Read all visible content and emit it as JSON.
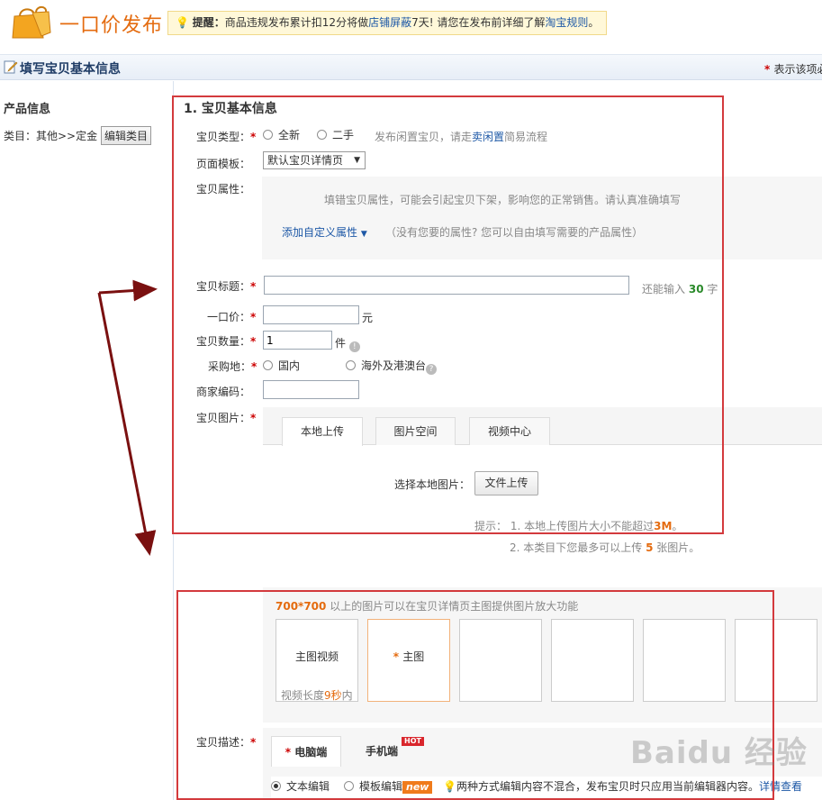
{
  "header": {
    "title": "一口价发布",
    "tip_label": "提醒：",
    "tip_text": "商品违规发布累计扣12分将做",
    "tip_link1": "店铺屏蔽",
    "tip_mid": "7天! 请您在发布前详细了解",
    "tip_link2": "淘宝规则",
    "tip_end": "。"
  },
  "bar": {
    "title": "填写宝贝基本信息",
    "required_note": "表示该项必"
  },
  "sidebar": {
    "section_title": "产品信息",
    "category_label": "类目：其他>>定金",
    "edit_button": "编辑类目"
  },
  "form": {
    "section_title": "1. 宝贝基本信息",
    "type_label": "宝贝类型：",
    "type_options": [
      "全新",
      "二手"
    ],
    "type_hint_pre": "发布闲置宝贝，请走",
    "type_hint_link": "卖闲置",
    "type_hint_post": "简易流程",
    "template_label": "页面模板：",
    "template_value": "默认宝贝详情页",
    "attr_label": "宝贝属性：",
    "attr_warning": "填错宝贝属性，可能会引起宝贝下架，影响您的正常销售。请认真准确填写",
    "attr_custom_link": "添加自定义属性",
    "attr_custom_hint": "（没有您要的属性? 您可以自由填写需要的产品属性）",
    "title_label": "宝贝标题：",
    "title_value": "",
    "title_remaining_pre": "还能输入",
    "title_remaining_count": "30",
    "title_remaining_post": "字",
    "price_label": "一口价：",
    "price_value": "",
    "price_unit": "元",
    "qty_label": "宝贝数量：",
    "qty_value": "1",
    "qty_unit": "件",
    "origin_label": "采购地：",
    "origin_options": [
      "国内",
      "海外及港澳台"
    ],
    "code_label": "商家编码：",
    "code_value": "",
    "images_label": "宝贝图片："
  },
  "upload": {
    "tabs": [
      "本地上传",
      "图片空间",
      "视频中心"
    ],
    "choose_label": "选择本地图片：",
    "file_button": "文件上传",
    "hint_prefix": "提示：",
    "hint1_pre": "1.  本地上传图片大小不能超过",
    "hint1_value": "3M",
    "hint1_post": "。",
    "hint2_pre": "2.  本类目下您最多可以上传",
    "hint2_value": "5",
    "hint2_post": "张图片。"
  },
  "image_slots": {
    "zoom_hint_size": "700*700",
    "zoom_hint_text": "以上的图片可以在宝贝详情页主图提供图片放大功能",
    "video_slot_title": "主图视频",
    "video_slot_note_pre": "视频长度",
    "video_slot_note_value": "9秒",
    "video_slot_note_post": "内",
    "main_slot_title": "主图"
  },
  "description": {
    "label": "宝贝描述：",
    "tabs": [
      "电脑端",
      "手机端"
    ],
    "hot_badge": "HOT",
    "mode_text": "文本编辑",
    "mode_template": "模板编辑",
    "new_badge": "new",
    "mode_note": "两种方式编辑内容不混合，发布宝贝时只应用当前编辑器内容。",
    "details_link": "详情查看"
  },
  "watermark": "Baidu 经验",
  "colors": {
    "accent": "#e46b0f",
    "link": "#1d58a6",
    "required": "#cc0000",
    "annotation": "#d33a3d",
    "arrow": "#7a1010"
  },
  "icons": [
    "shopping-bag-icon",
    "bulb-icon",
    "edit-icon",
    "help-icon",
    "chevron-down-icon"
  ]
}
